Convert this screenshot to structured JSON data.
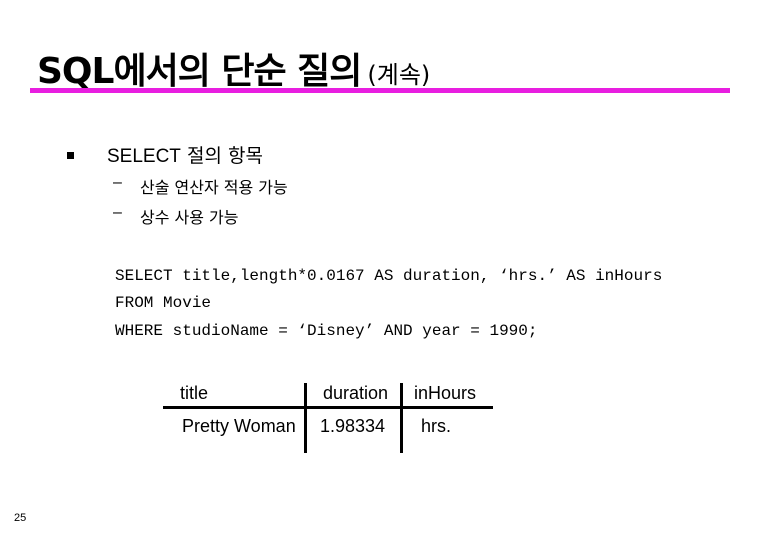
{
  "slide": {
    "title_main": "SQL에서의 단순 질의",
    "title_sub": "(계속)",
    "accent_color": "#e81ee0",
    "page_number": "25"
  },
  "bullets": [
    {
      "keyword": "SELECT",
      "text": " 절의 항목",
      "subitems": [
        {
          "dash": "–",
          "text": "산술 연산자 적용 가능"
        },
        {
          "dash": "–",
          "text": "상수 사용 가능"
        }
      ]
    }
  ],
  "code": {
    "lines": [
      "SELECT title,length*0.0167 AS duration, ‘hrs.’ AS inHours",
      "FROM Movie",
      "WHERE studioName = ‘Disney’ AND year = 1990;"
    ]
  },
  "result_table": {
    "headers": [
      "title",
      "duration",
      "inHours"
    ],
    "rows": [
      [
        "Pretty Woman",
        "1.98334",
        "hrs."
      ]
    ]
  }
}
